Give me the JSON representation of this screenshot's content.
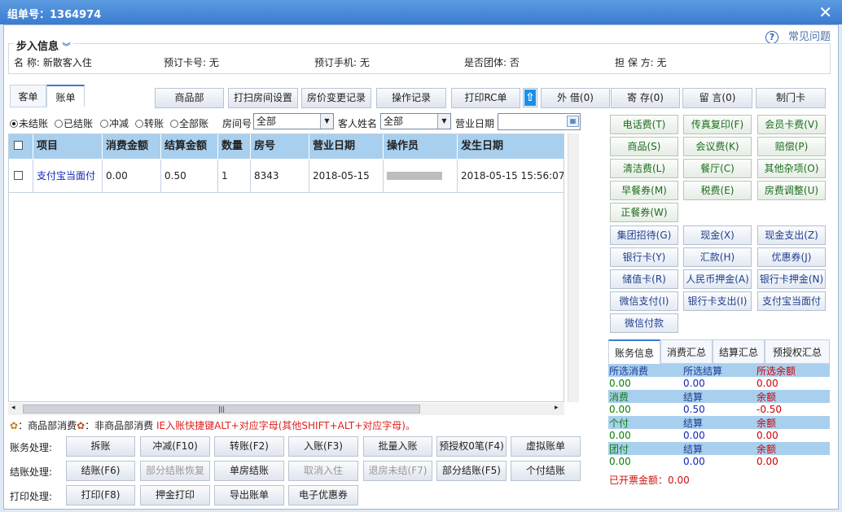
{
  "title": "组单号：1364974",
  "close_glyph": "✕",
  "help": {
    "icon": "?",
    "label": "常见问题"
  },
  "section": {
    "title": "步入信息",
    "chev": "︾"
  },
  "info": [
    {
      "label": "名 称: ",
      "value": "新散客入住"
    },
    {
      "label": "预订卡号: ",
      "value": "无"
    },
    {
      "label": "预订手机: ",
      "value": "无"
    },
    {
      "label": "是否团体: ",
      "value": "否"
    },
    {
      "label": "担 保 方: ",
      "value": "无"
    }
  ],
  "tabs": [
    "客单",
    "账单"
  ],
  "toolbar": [
    "商品部",
    "打扫房间设置",
    "房价变更记录",
    "操作记录",
    "打印RC单",
    "外 借(0)",
    "寄 存(0)",
    "留 言(0)",
    "制门卡"
  ],
  "upload_glyph": "⇧",
  "filters": {
    "radios": [
      "未结账",
      "已结账",
      "冲减",
      "转账",
      "全部账"
    ],
    "room_label": "房间号",
    "room_value": "全部",
    "guest_label": "客人姓名",
    "guest_value": "全部",
    "date_label": "营业日期",
    "date_value": ""
  },
  "grid": {
    "columns": [
      "项目",
      "消费金额",
      "结算金额",
      "数量",
      "房号",
      "营业日期",
      "操作员",
      "发生日期"
    ],
    "rows": [
      {
        "item": "支付宝当面付",
        "consume": "0.00",
        "settle": "0.50",
        "qty": "1",
        "room": "8343",
        "bizdate": "2018-05-15",
        "operator": "",
        "time": "2018-05-15 15:56:07"
      }
    ]
  },
  "legend": {
    "a": "：商品部消费",
    "b": "：非商品部消费",
    "hint": "IE入账快捷键ALT+对应字母(其他SHIFT+ALT+对应字母)。"
  },
  "actions": {
    "account_label": "账务处理:",
    "account": [
      "拆账",
      "冲减(F10)",
      "转账(F2)",
      "入账(F3)",
      "批量入账",
      "预授权0笔(F4)",
      "虚拟账单"
    ],
    "checkout_label": "结账处理:",
    "checkout": [
      "结账(F6)",
      "部分结账恢复",
      "单房结账",
      "取消入住",
      "退房未结(F7)",
      "部分结账(F5)",
      "个付结账"
    ],
    "print_label": "打印处理:",
    "print": [
      "打印(F8)",
      "押金打印",
      "导出账单",
      "电子优惠券"
    ]
  },
  "charges": [
    "电话费(T)",
    "传真复印(F)",
    "会员卡费(V)",
    "商品(S)",
    "会议费(K)",
    "赔偿(P)",
    "清洁费(L)",
    "餐厅(C)",
    "其他杂项(O)",
    "早餐券(M)",
    "税费(E)",
    "房费调整(U)",
    "正餐券(W)"
  ],
  "payments": [
    "集团招待(G)",
    "现金(X)",
    "现金支出(Z)",
    "银行卡(Y)",
    "汇款(H)",
    "优惠券(J)",
    "储值卡(R)",
    "人民币押金(A)",
    "银行卡押金(N)",
    "微信支付(I)",
    "银行卡支出(I)",
    "支付宝当面付",
    "微信付款"
  ],
  "summary_tabs": [
    "账务信息",
    "消费汇总",
    "结算汇总",
    "预授权汇总"
  ],
  "summary": [
    {
      "h": [
        "所选消费",
        "所选结算",
        "所选余额"
      ],
      "v": [
        "0.00",
        "0.00",
        "0.00"
      ]
    },
    {
      "h": [
        "消费",
        "结算",
        "余额"
      ],
      "v": [
        "0.00",
        "0.50",
        "-0.50"
      ]
    },
    {
      "h": [
        "个付",
        "结算",
        "余额"
      ],
      "v": [
        "0.00",
        "0.00",
        "0.00"
      ]
    },
    {
      "h": [
        "团付",
        "结算",
        "余额"
      ],
      "v": [
        "0.00",
        "0.00",
        "0.00"
      ]
    }
  ],
  "invoiced": "已开票金额：0.00",
  "colors": {
    "titlebar": "#3a7bd0",
    "header": "#a8cfee",
    "green": "#0a7f0a",
    "red": "#d00000"
  }
}
